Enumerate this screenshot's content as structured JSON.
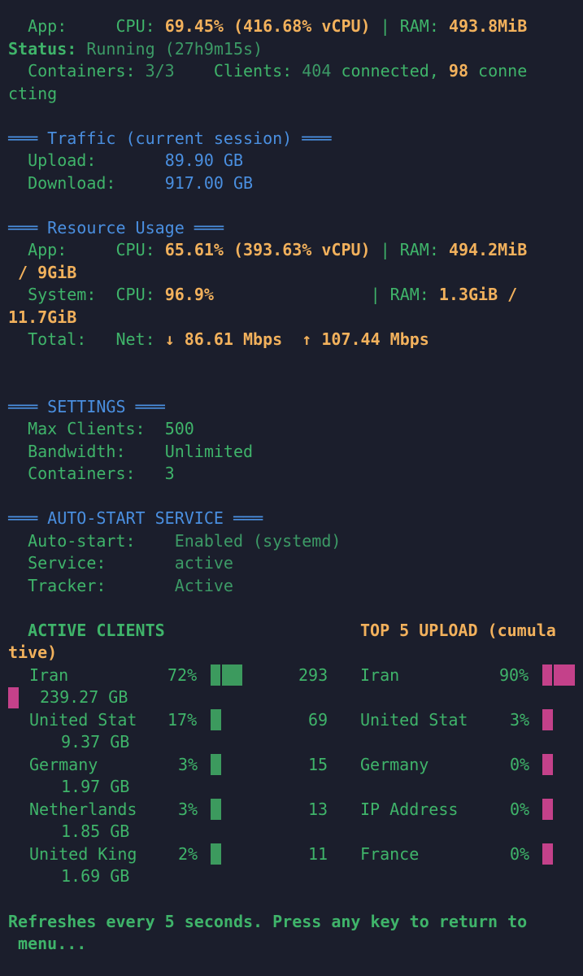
{
  "status": {
    "app_label": "App:",
    "cpu_label": "CPU:",
    "app_cpu": "69.45% (416.68% vCPU)",
    "pipe": "|",
    "ram_label": "RAM:",
    "app_ram": "493.8MiB",
    "status_label": "Status:",
    "status_value": "Running (27h9m15s)",
    "containers_label": "Containers:",
    "containers_value": "3/3",
    "clients_label": "Clients:",
    "clients_count": "404",
    "connected_text": "connected,",
    "connecting_count": "98",
    "connecting_text_1": "conne",
    "connecting_text_2": "cting"
  },
  "traffic": {
    "header": "═══ Traffic (current session) ═══",
    "upload_label": "Upload:",
    "upload_value": "89.90 GB",
    "download_label": "Download:",
    "download_value": "917.00 GB"
  },
  "resource": {
    "header": "═══ Resource Usage ═══",
    "app_label": "App:",
    "cpu_label": "CPU:",
    "app_cpu": "65.61% (393.63% vCPU)",
    "pipe": "|",
    "ram_label": "RAM:",
    "app_ram_1": "494.2MiB",
    "app_ram_2": "/ 9GiB",
    "system_label": "System:",
    "system_cpu": "96.9%",
    "system_ram_1": "1.3GiB /",
    "system_ram_2": "11.7GiB",
    "total_label": "Total:",
    "net_label": "Net:",
    "net_down": "↓ 86.61 Mbps",
    "net_up": "↑ 107.44 Mbps"
  },
  "settings": {
    "header": "═══ SETTINGS ═══",
    "max_clients_label": "Max Clients:",
    "max_clients_value": "500",
    "bandwidth_label": "Bandwidth:",
    "bandwidth_value": "Unlimited",
    "containers_label": "Containers:",
    "containers_value": "3"
  },
  "autostart": {
    "header": "═══ AUTO-START SERVICE ═══",
    "autostart_label": "Auto-start:",
    "autostart_value": "Enabled (systemd)",
    "service_label": "Service:",
    "service_value": "active",
    "tracker_label": "Tracker:",
    "tracker_value": "Active"
  },
  "clients": {
    "active_header": "ACTIVE CLIENTS",
    "upload_header_1": "TOP 5 UPLOAD (cumula",
    "upload_header_2": "tive)",
    "rows": [
      {
        "country": "Iran",
        "pct": "72%",
        "count": "293",
        "traffic": "239.27 GB",
        "up_country": "Iran",
        "up_pct": "90%"
      },
      {
        "country": "United Stat",
        "pct": "17%",
        "count": "69",
        "traffic": "9.37 GB",
        "up_country": "United Stat",
        "up_pct": "3%"
      },
      {
        "country": "Germany",
        "pct": "3%",
        "count": "15",
        "traffic": "1.97 GB",
        "up_country": "Germany",
        "up_pct": "0%"
      },
      {
        "country": "Netherlands",
        "pct": "3%",
        "count": "13",
        "traffic": "1.85 GB",
        "up_country": "IP Address",
        "up_pct": "0%"
      },
      {
        "country": "United King",
        "pct": "2%",
        "count": "11",
        "traffic": "1.69 GB",
        "up_country": "France",
        "up_pct": "0%"
      }
    ]
  },
  "footer": {
    "line1": "Refreshes every 5 seconds. Press any key to return to",
    "line2": " menu..."
  },
  "colors": {
    "background": "#1b1e2c",
    "green": "#3fb46a",
    "orange": "#f2b15c",
    "blue": "#4a8fe0",
    "bar_green": "#3c9a5e",
    "bar_pink": "#c4418a"
  }
}
